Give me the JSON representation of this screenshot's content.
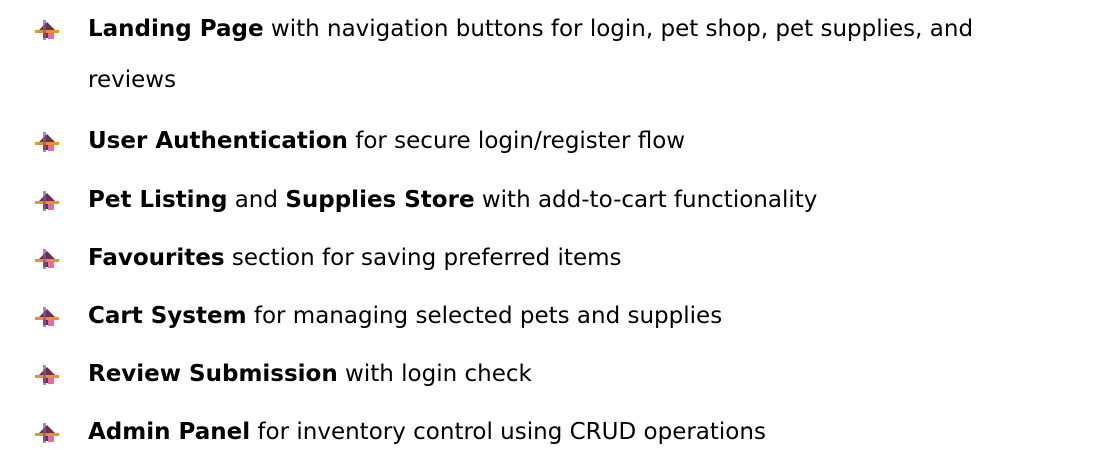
{
  "bullet_icon": "arrow-bullet-icon",
  "bullet_colors": {
    "dark": "#6b2f4f",
    "orange": "#e8922a",
    "purple": "#7d54a8",
    "pink": "#e96aa0"
  },
  "features": [
    {
      "bold": "Landing Page",
      "text": " with navigation buttons for login, pet shop, pet supplies, and",
      "text_cont": "reviews"
    },
    {
      "bold": "User Authentication",
      "text": " for secure login/register flow"
    },
    {
      "bold": "Pet Listing",
      "mid": " and ",
      "bold2": "Supplies Store",
      "text": " with add-to-cart functionality"
    },
    {
      "bold": "Favourites",
      "text": " section for saving preferred items"
    },
    {
      "bold": "Cart System",
      "text": " for managing selected pets and supplies"
    },
    {
      "bold": "Review Submission",
      "text": " with login check"
    },
    {
      "bold": "Admin Panel",
      "text": " for inventory control using CRUD operations"
    }
  ]
}
